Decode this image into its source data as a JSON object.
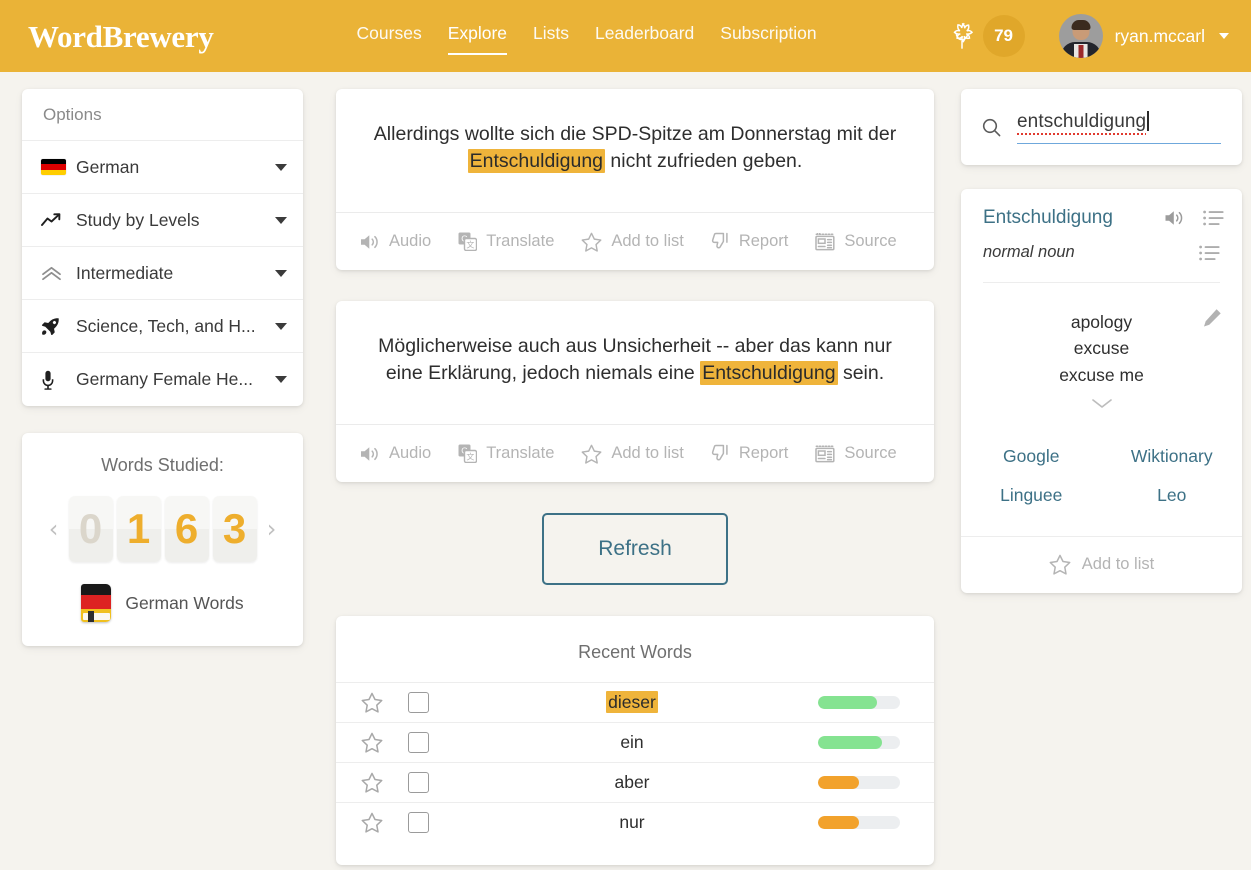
{
  "header": {
    "brand": "WordBrewery",
    "nav": [
      {
        "label": "Courses",
        "active": false
      },
      {
        "label": "Explore",
        "active": true
      },
      {
        "label": "Lists",
        "active": false
      },
      {
        "label": "Leaderboard",
        "active": false
      },
      {
        "label": "Subscription",
        "active": false
      }
    ],
    "xp": "79",
    "username": "ryan.mccarl",
    "brand_color": "#eab337"
  },
  "options": {
    "title": "Options",
    "items": [
      {
        "icon": "german-flag-icon",
        "label": "German"
      },
      {
        "icon": "trend-up-icon",
        "label": "Study by Levels"
      },
      {
        "icon": "double-chevron-up-icon",
        "label": "Intermediate"
      },
      {
        "icon": "rocket-icon",
        "label": "Science, Tech, and H..."
      },
      {
        "icon": "microphone-icon",
        "label": "Germany Female He..."
      }
    ]
  },
  "words_studied": {
    "title": "Words Studied:",
    "digits": [
      "0",
      "1",
      "6",
      "3"
    ],
    "dim_digits": [
      true,
      false,
      false,
      false
    ],
    "footer_label": "German Words",
    "prev_label": "‹",
    "next_label": "›"
  },
  "sentences": [
    {
      "pre": "Allerdings wollte sich die SPD-Spitze am Donnerstag mit der ",
      "highlight": "Entschuldigung",
      "post": " nicht zufrieden geben.",
      "actions": [
        {
          "icon": "speaker-icon",
          "label": "Audio"
        },
        {
          "icon": "google-translate-icon",
          "label": "Translate"
        },
        {
          "icon": "star-icon",
          "label": "Add to list"
        },
        {
          "icon": "thumbs-down-icon",
          "label": "Report"
        },
        {
          "icon": "newspaper-icon",
          "label": "Source"
        }
      ]
    },
    {
      "pre": "Möglicherweise auch aus Unsicherheit -- aber das kann nur eine Erklärung, jedoch niemals eine ",
      "highlight": "Entschuldigung",
      "post": " sein.",
      "actions": [
        {
          "icon": "speaker-icon",
          "label": "Audio"
        },
        {
          "icon": "google-translate-icon",
          "label": "Translate"
        },
        {
          "icon": "star-icon",
          "label": "Add to list"
        },
        {
          "icon": "thumbs-down-icon",
          "label": "Report"
        },
        {
          "icon": "newspaper-icon",
          "label": "Source"
        }
      ]
    }
  ],
  "refresh": {
    "label": "Refresh",
    "color": "#3d7186"
  },
  "recent_words": {
    "title": "Recent Words",
    "rows": [
      {
        "word": "dieser",
        "highlighted": true,
        "progress": 72,
        "color": "#85e391"
      },
      {
        "word": "ein",
        "highlighted": false,
        "progress": 78,
        "color": "#85e391"
      },
      {
        "word": "aber",
        "highlighted": false,
        "progress": 50,
        "color": "#f2a22c"
      },
      {
        "word": "nur",
        "highlighted": false,
        "progress": 50,
        "color": "#f2a22c"
      }
    ]
  },
  "search": {
    "value": "entschuldigung",
    "placeholder": "Search",
    "icon": "search-icon"
  },
  "dictionary": {
    "word": "Entschuldigung",
    "pos": "normal noun",
    "definitions": [
      "apology",
      "excuse",
      "excuse me"
    ],
    "links": [
      "Google",
      "Wiktionary",
      "Linguee",
      "Leo"
    ],
    "add_to_list": "Add to list"
  }
}
